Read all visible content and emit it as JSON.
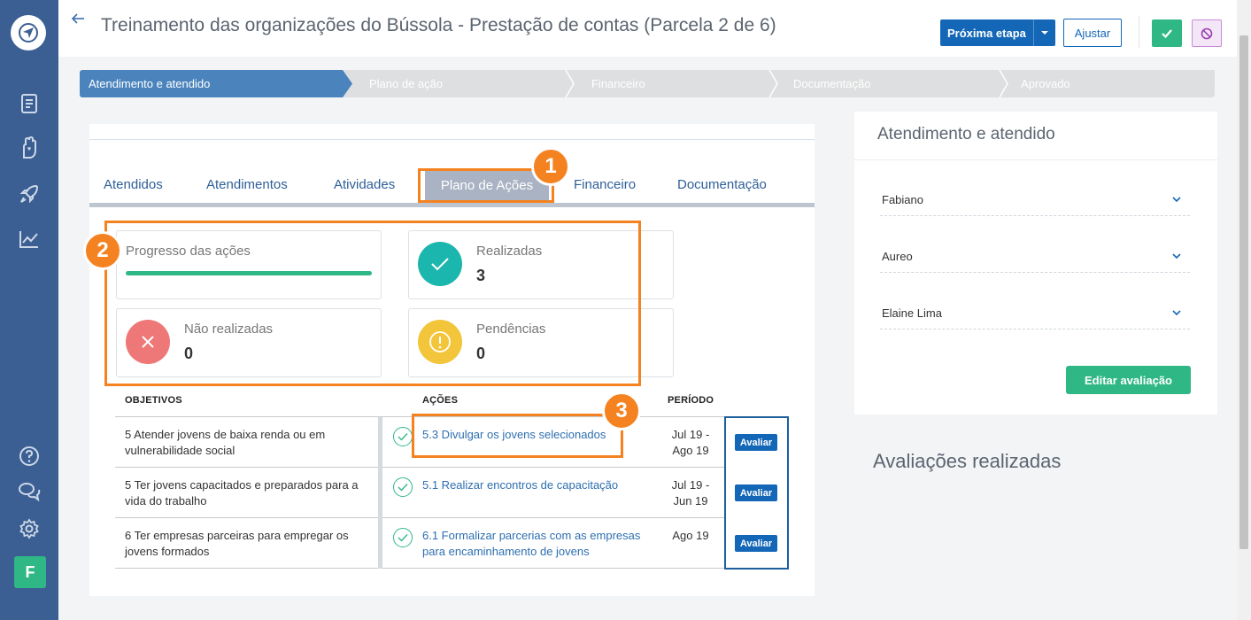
{
  "header": {
    "title": "Treinamento das organizações do Bússola - Prestação de contas (Parcela 2 de 6)",
    "next_step_label": "Próxima etapa",
    "adjust_label": "Ajustar"
  },
  "sidebar": {
    "items": [
      {
        "icon": "document-icon"
      },
      {
        "icon": "hand-heart-icon"
      },
      {
        "icon": "rocket-icon"
      },
      {
        "icon": "chart-icon"
      },
      {
        "icon": "help-icon"
      },
      {
        "icon": "chat-icon"
      },
      {
        "icon": "gear-icon"
      }
    ],
    "avatar_initial": "F"
  },
  "stepper": {
    "steps": [
      {
        "label": "Atendimento e atendido",
        "active": true
      },
      {
        "label": "Plano de ação",
        "active": false
      },
      {
        "label": "Financeiro",
        "active": false
      },
      {
        "label": "Documentação",
        "active": false
      },
      {
        "label": "Aprovado",
        "active": false
      }
    ]
  },
  "tabs": [
    {
      "label": "Atendidos"
    },
    {
      "label": "Atendimentos"
    },
    {
      "label": "Atividades"
    },
    {
      "label": "Plano de Ações",
      "active": true
    },
    {
      "label": "Financeiro"
    },
    {
      "label": "Documentação"
    }
  ],
  "stats": {
    "progress": {
      "label": "Progresso das ações",
      "fraction": 1.0
    },
    "done": {
      "label": "Realizadas",
      "value": "3"
    },
    "not_done": {
      "label": "Não realizadas",
      "value": "0"
    },
    "pending": {
      "label": "Pendências",
      "value": "0"
    }
  },
  "table": {
    "headers": {
      "objectives": "OBJETIVOS",
      "actions": "AÇÕES",
      "period": "PERÍODO"
    },
    "rows": [
      {
        "objective_l1": "5 Atender jovens de baixa renda ou em",
        "objective_l2": "vulnerabilidade social",
        "action_l1": "5.3 Divulgar os jovens selecionados",
        "action_l2": "",
        "period_l1": "Jul 19 -",
        "period_l2": "Ago 19",
        "button": "Avaliar"
      },
      {
        "objective_l1": "5 Ter jovens capacitados e preparados para a",
        "objective_l2": "vida do trabalho",
        "action_l1": "5.1 Realizar encontros de capacitação",
        "action_l2": "",
        "period_l1": "Jul 19 -",
        "period_l2": "Jun 19",
        "button": "Avaliar"
      },
      {
        "objective_l1": "6 Ter empresas parceiras para empregar os",
        "objective_l2": "jovens formados",
        "action_l1": "6.1 Formalizar parcerias com as empresas",
        "action_l2": "para encaminhamento de jovens",
        "period_l1": "Ago 19",
        "period_l2": "",
        "button": "Avaliar"
      }
    ]
  },
  "right_panel": {
    "title": "Atendimento e atendido",
    "selects": [
      {
        "value": "Fabiano"
      },
      {
        "value": "Aureo"
      },
      {
        "value": "Elaine Lima"
      }
    ],
    "edit_button": "Editar avaliação",
    "evaluations_title": "Avaliações realizadas"
  },
  "annotations": {
    "badge1": "1",
    "badge2": "2",
    "badge3": "3",
    "color": "#f58220"
  },
  "colors": {
    "sidebar": "#3b5f93",
    "primary": "#1467b7",
    "success": "#2fb886",
    "danger": "#ee7777",
    "warning": "#f3c53a",
    "teal": "#1bb6ad"
  }
}
